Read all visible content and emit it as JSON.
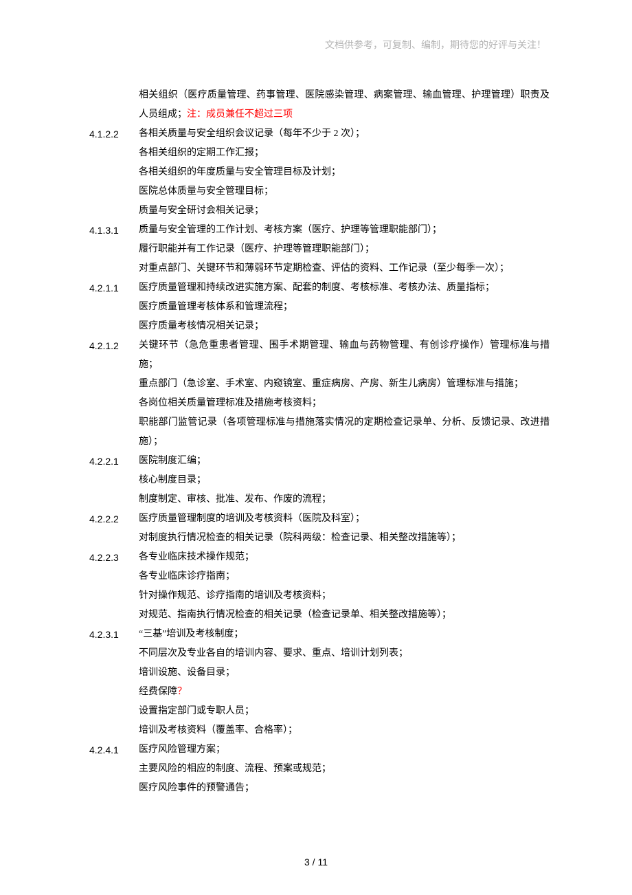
{
  "header": "文档供参考，可复制、编制，期待您的好评与关注！",
  "intro": {
    "l1_pre": "相关组织（医疗质量管理、药事管理、医院感染管理、病案管理、输血管理、护理管理）职责及人员组成；",
    "l1_red": "注：成员兼任不超过三项"
  },
  "sections": [
    {
      "num": "4.1.2.2",
      "lines": [
        "各相关质量与安全组织会议记录（每年不少于 2 次）；",
        "各相关组织的定期工作汇报；",
        "各相关组织的年度质量与安全管理目标及计划；",
        "医院总体质量与安全管理目标；",
        "质量与安全研讨会相关记录；"
      ]
    },
    {
      "num": "4.1.3.1",
      "lines": [
        "质量与安全管理的工作计划、考核方案（医疗、护理等管理职能部门）；",
        "履行职能并有工作记录（医疗、护理等管理职能部门）；",
        "对重点部门、关键环节和薄弱环节定期检查、评估的资料、工作记录（至少每季一次）；"
      ]
    },
    {
      "num": "4.2.1.1",
      "lines": [
        "医疗质量管理和持续改进实施方案、配套的制度、考核标准、考核办法、质量指标；",
        "医疗质量管理考核体系和管理流程；",
        "医疗质量考核情况相关记录；"
      ]
    },
    {
      "num": "4.2.1.2",
      "lines": [
        "关键环节（急危重患者管理、围手术期管理、输血与药物管理、有创诊疗操作）管理标准与措施；",
        "重点部门（急诊室、手术室、内窥镜室、重症病房、产房、新生儿病房）管理标准与措施；",
        "各岗位相关质量管理标准及措施考核资料；",
        "职能部门监管记录（各项管理标准与措施落实情况的定期检查记录单、分析、反馈记录、改进措施）；"
      ]
    },
    {
      "num": "4.2.2.1",
      "lines": [
        "医院制度汇编；",
        "核心制度目录；",
        "制度制定、审核、批准、发布、作废的流程；"
      ]
    },
    {
      "num": "4.2.2.2",
      "lines": [
        "医疗质量管理制度的培训及考核资料（医院及科室）；",
        "对制度执行情况检查的相关记录（院科两级：检查记录、相关整改措施等）；"
      ]
    },
    {
      "num": "4.2.2.3",
      "lines": [
        "各专业临床技术操作规范；",
        "各专业临床诊疗指南；",
        "针对操作规范、诊疗指南的培训及考核资料；",
        "对规范、指南执行情况检查的相关记录（检查记录单、相关整改措施等）；"
      ]
    },
    {
      "num": "4.2.3.1",
      "lines_special": [
        {
          "t": "“三基”培训及考核制度；",
          "red": ""
        },
        {
          "t": "不同层次及专业各自的培训内容、要求、重点、培训计划列表；",
          "red": ""
        },
        {
          "t": "培训设施、设备目录；",
          "red": ""
        },
        {
          "t": "经费保障",
          "red": "？"
        },
        {
          "t": "设置指定部门或专职人员；",
          "red": ""
        },
        {
          "t": "培训及考核资料（覆盖率、合格率）；",
          "red": ""
        }
      ]
    },
    {
      "num": "4.2.4.1",
      "lines": [
        "医疗风险管理方案；",
        "主要风险的相应的制度、流程、预案或规范；",
        "医疗风险事件的预警通告；"
      ]
    }
  ],
  "page_number": "3 / 11"
}
